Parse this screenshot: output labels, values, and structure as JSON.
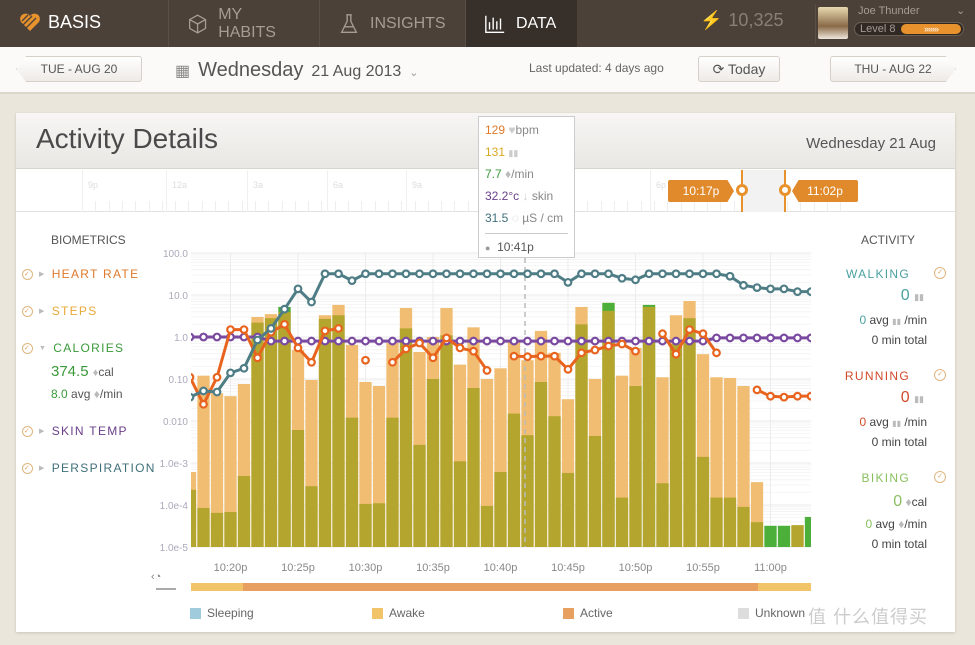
{
  "header": {
    "brand": "BASIS",
    "nav": [
      {
        "label": "MY HABITS",
        "icon": "cube-icon"
      },
      {
        "label": "INSIGHTS",
        "icon": "flask-icon"
      },
      {
        "label": "DATA",
        "icon": "bar-chart-icon",
        "active": true
      }
    ],
    "points": "10,325",
    "user": {
      "name": "Joe Thunder",
      "level": "Level 8",
      "level_arrows": "›››››››"
    }
  },
  "subheader": {
    "prev": "TUE - AUG 20",
    "day": "Wednesday",
    "date": "21 Aug 2013",
    "last_updated": "Last updated: 4 days ago",
    "today": "Today",
    "next": "THU - AUG 22"
  },
  "card": {
    "title": "Activity Details",
    "date": "Wednesday 21 Aug",
    "timeline_labels": [
      "9p",
      "12a",
      "3a",
      "6a",
      "9a",
      "12p",
      "3p",
      "6p"
    ],
    "range_start": "10:17p",
    "range_end": "11:02p"
  },
  "tooltip": {
    "heart_rate": "129",
    "heart_unit": "bpm",
    "steps": "131",
    "calories": "7.7",
    "calories_unit": "/min",
    "skin_temp": "32.2°c",
    "skin_unit": "skin",
    "perspiration": "31.5",
    "perspiration_unit": "µS / cm",
    "time": "10:41p"
  },
  "biometrics": {
    "title": "BIOMETRICS",
    "items": [
      {
        "label": "HEART RATE",
        "color": "#e07a2a"
      },
      {
        "label": "STEPS",
        "color": "#e8a838"
      },
      {
        "label": "CALORIES",
        "color": "#3a9a3a"
      },
      {
        "label": "SKIN TEMP",
        "color": "#6a3f8a"
      },
      {
        "label": "PERSPIRATION",
        "color": "#3f6f7a"
      }
    ],
    "calories_total": "374.5",
    "calories_unit": "cal",
    "calories_avg": "8.0",
    "avg_label": "avg",
    "per_min": "/min"
  },
  "activity": {
    "title": "ACTIVITY",
    "items": [
      {
        "label": "WALKING",
        "value": "0",
        "avg": "0",
        "avg_label": "avg",
        "per_min": "/min",
        "total": "0 min total",
        "color": "#4aa0a0"
      },
      {
        "label": "RUNNING",
        "value": "0",
        "avg": "0",
        "avg_label": "avg",
        "per_min": "/min",
        "total": "0 min total",
        "color": "#d04a2a"
      },
      {
        "label": "BIKING",
        "value": "0",
        "unit": "cal",
        "avg": "0",
        "avg_label": "avg",
        "per_min": "/min",
        "total": "0 min total",
        "color": "#8ac060"
      }
    ]
  },
  "chart_data": {
    "type": "bar",
    "y_scale": "log",
    "ylim": [
      1e-05,
      100
    ],
    "y_ticks": [
      "100.0",
      "10.0",
      "1.0",
      "0.10",
      "0.010",
      "1.0e-3",
      "1.0e-4",
      "1.0e-5"
    ],
    "x_start": "10:17p",
    "x_end": "11:02p",
    "x_ticks": [
      "10:20p",
      "10:25p",
      "10:30p",
      "10:35p",
      "10:40p",
      "10:45p",
      "10:50p",
      "10:55p",
      "11:00p"
    ],
    "grid": true,
    "bars_total": [
      0.00061,
      0.12,
      0.046,
      0.039,
      0.076,
      3.0,
      3.5,
      5.2,
      0.49,
      0.095,
      3.3,
      5.8,
      0.65,
      0.085,
      0.068,
      0.72,
      4.9,
      0.44,
      1.0,
      4.9,
      0.22,
      1.7,
      0.1,
      0.18,
      0.76,
      0.28,
      1.4,
      0.42,
      0.033,
      5.2,
      0.1,
      6.5,
      0.12,
      0.55,
      5.8,
      0.11,
      3.3,
      7.2,
      0.39,
      0.11,
      0.106,
      0.068,
      0.00035,
      3.2e-05,
      3.2e-05,
      3.3e-05,
      5.2e-05
    ],
    "bars_active": [
      0.00023,
      8.5e-05,
      6.5e-05,
      6.8e-05,
      0.00049,
      2.2,
      2.8,
      3.9,
      0.0061,
      0.00028,
      2.7,
      3.3,
      0.012,
      0.000106,
      0.00011,
      0.012,
      1.6,
      0.0027,
      0.1,
      1.1,
      0.0011,
      0.061,
      9.5e-05,
      0.00061,
      0.015,
      0.0046,
      0.085,
      0.013,
      0.00058,
      2.0,
      0.0044,
      4.2,
      0.00015,
      0.068,
      5.2,
      0.00033,
      0.68,
      2.8,
      0.0014,
      0.00015,
      0.00015,
      9e-05,
      3.9e-05,
      null,
      null,
      3.3e-05,
      null
    ],
    "bars_green_top": [
      null,
      null,
      null,
      null,
      null,
      null,
      null,
      5.2,
      null,
      null,
      null,
      null,
      null,
      null,
      null,
      null,
      null,
      null,
      null,
      null,
      null,
      null,
      null,
      null,
      null,
      null,
      null,
      null,
      null,
      null,
      null,
      6.5,
      null,
      null,
      5.8,
      null,
      null,
      null,
      null,
      null,
      null,
      null,
      null,
      3.2e-05,
      3.2e-05,
      null,
      5.2e-05
    ],
    "colors": {
      "awake_bar": "#f0bd72",
      "active_bar": "#b3a52e",
      "green_bar": "#4caf3a",
      "heart_rate": "#e8641e",
      "skin_temp": "#7a4aa0",
      "perspiration": "#4f7d85"
    },
    "lines": {
      "perspiration": [
        0.037,
        0.052,
        0.049,
        0.14,
        0.18,
        0.85,
        1.6,
        4.6,
        14,
        6.8,
        32,
        32,
        22,
        32,
        32,
        32,
        32,
        32,
        32,
        32,
        32,
        32,
        32,
        32,
        32,
        32,
        32,
        32,
        20,
        32,
        32,
        32,
        25,
        23,
        32,
        32,
        32,
        32,
        32,
        32,
        28,
        17,
        15,
        14,
        14,
        12,
        12
      ],
      "skin_temp": [
        1.0,
        1.0,
        1.0,
        1.0,
        1.0,
        1.0,
        0.8,
        0.8,
        0.8,
        0.8,
        0.8,
        0.8,
        0.8,
        0.8,
        0.8,
        0.8,
        0.8,
        0.8,
        0.8,
        0.8,
        0.8,
        0.8,
        0.8,
        0.8,
        0.8,
        0.8,
        0.8,
        0.8,
        0.8,
        0.8,
        0.8,
        0.8,
        0.8,
        0.8,
        0.8,
        0.8,
        0.8,
        0.8,
        0.8,
        0.95,
        0.95,
        0.95,
        0.95,
        0.95,
        0.95,
        0.95,
        0.95
      ],
      "heart_rate": [
        0.11,
        0.025,
        0.11,
        1.5,
        1.5,
        0.32,
        1.3,
        2.0,
        0.55,
        0.25,
        1.4,
        1.6,
        null,
        0.28,
        null,
        0.25,
        0.52,
        0.72,
        0.32,
        0.95,
        0.55,
        0.46,
        0.16,
        null,
        0.35,
        0.34,
        0.35,
        0.35,
        0.17,
        0.42,
        0.49,
        0.61,
        0.68,
        0.46,
        null,
        1.2,
        0.39,
        1.5,
        1.2,
        0.42,
        null,
        null,
        0.055,
        0.039,
        0.037,
        0.039,
        0.039
      ]
    },
    "state_strip": [
      {
        "state": "Awake",
        "from": "10:17p",
        "to": "10:21p"
      },
      {
        "state": "Active",
        "from": "10:21p",
        "to": "10:59p"
      },
      {
        "state": "Awake",
        "from": "10:59p",
        "to": "11:02p"
      }
    ],
    "legend": [
      {
        "label": "Sleeping",
        "color": "#9fcbdc"
      },
      {
        "label": "Awake",
        "color": "#f2c46a"
      },
      {
        "label": "Active",
        "color": "#e8a060"
      },
      {
        "label": "Unknown",
        "color": "#dddddd"
      }
    ]
  },
  "watermark": "值 什么值得买"
}
